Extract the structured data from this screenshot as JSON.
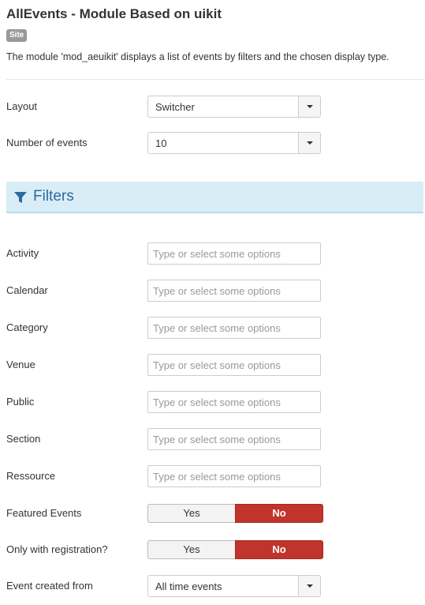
{
  "header": {
    "title": "AllEvents - Module Based on uikit",
    "badge": "Site",
    "description": "The module 'mod_aeuikit' displays a list of events by filters and the chosen display type."
  },
  "settings": {
    "layout": {
      "label": "Layout",
      "value": "Switcher"
    },
    "number_of_events": {
      "label": "Number of events",
      "value": "10"
    }
  },
  "filters": {
    "title": "Filters",
    "icon": "filter-icon",
    "fields": [
      {
        "label": "Activity",
        "placeholder": "Type or select some options"
      },
      {
        "label": "Calendar",
        "placeholder": "Type or select some options"
      },
      {
        "label": "Category",
        "placeholder": "Type or select some options"
      },
      {
        "label": "Venue",
        "placeholder": "Type or select some options"
      },
      {
        "label": "Public",
        "placeholder": "Type or select some options"
      },
      {
        "label": "Section",
        "placeholder": "Type or select some options"
      },
      {
        "label": "Ressource",
        "placeholder": "Type or select some options"
      }
    ],
    "featured_events": {
      "label": "Featured Events",
      "yes": "Yes",
      "no": "No",
      "selected": "No"
    },
    "only_with_registration": {
      "label": "Only with registration?",
      "yes": "Yes",
      "no": "No",
      "selected": "No"
    },
    "event_created_from": {
      "label": "Event created from",
      "value": "All time events"
    }
  },
  "colors": {
    "accent_header_bg": "#d9edf7",
    "accent_header_text": "#2d6a9f",
    "toggle_selected_no": "#c0342c"
  }
}
